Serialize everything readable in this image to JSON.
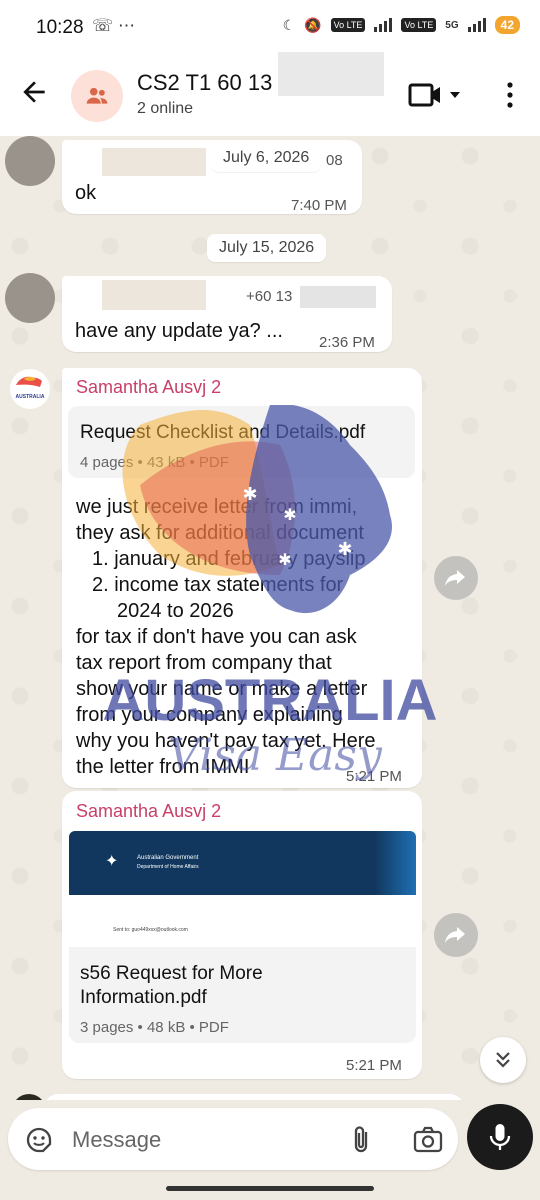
{
  "status_bar": {
    "time": "10:28",
    "battery": "42",
    "network": "5G"
  },
  "header": {
    "title": "CS2 T1 60 13",
    "subtitle": "2 online"
  },
  "messages": [
    {
      "type": "date",
      "label": "July 6, 2026"
    },
    {
      "type": "incoming",
      "phone_tail": "08",
      "text": "ok",
      "time": "7:40 PM"
    },
    {
      "type": "date",
      "label": "July 15, 2026"
    },
    {
      "type": "incoming",
      "phone_prefix": "+60 13",
      "text": "have any update ya? ...",
      "time": "2:36 PM"
    }
  ],
  "samantha_msg_1": {
    "sender": "Samantha Ausvj 2",
    "doc_name": "Request Checklist and Details.pdf",
    "doc_meta": "4 pages • 43 kB • PDF",
    "lines": [
      "we just receive letter from immi,",
      "they ask for additional document",
      "1. january and february payslip",
      "2. income tax statements for",
      "2024 to 2026",
      "for tax if don't have you can ask",
      "tax report from company that",
      "show your name or make a letter",
      "from your company explaining",
      "why you haven't pay tax yet. Here",
      "the letter from IMMI"
    ],
    "time": "5:21 PM"
  },
  "samantha_msg_2": {
    "sender": "Samantha Ausvj 2",
    "preview_header_line1": "Australian Government",
    "preview_header_line2": "Department of Home Affairs",
    "preview_sent_to": "Sent to: guo449xxx@outlook.com",
    "doc_name_line1": "s56 Request for More",
    "doc_name_line2": "Information.pdf",
    "doc_meta": "3 pages • 48 kB • PDF",
    "time": "5:21 PM"
  },
  "watermark": {
    "word1": "AUSTRALIA",
    "word2": "Visa Easy"
  },
  "composer": {
    "placeholder": "Message"
  },
  "colors": {
    "sender": "#c8406a",
    "chat_bg": "#efeae2",
    "bubble": "#ffffff",
    "mic_bg": "#1b1b1b"
  }
}
